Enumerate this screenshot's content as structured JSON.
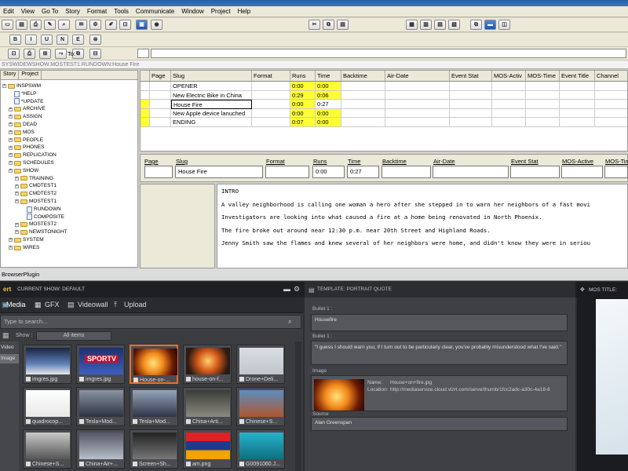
{
  "menu": [
    "Edit",
    "View",
    "Go To",
    "Story",
    "Format",
    "Tools",
    "Communicate",
    "Window",
    "Project",
    "Help"
  ],
  "format_buttons": [
    "B",
    "I",
    "U",
    "N",
    "E"
  ],
  "to_label": "To:",
  "path": "SYSWIDEWSHOW.MOSTEST1.RUNDOWN:House Fire",
  "tree": {
    "tabs": [
      "Story",
      "Project"
    ],
    "items": [
      {
        "label": "INSPSWM",
        "type": "folder",
        "indent": 0
      },
      {
        "label": "*HELP",
        "type": "doc",
        "indent": 1
      },
      {
        "label": "*UPDATE",
        "type": "doc",
        "indent": 1
      },
      {
        "label": "ARCHIVE",
        "type": "folder",
        "indent": 1
      },
      {
        "label": "ASSIGN",
        "type": "folder",
        "indent": 1
      },
      {
        "label": "DEAD",
        "type": "folder",
        "indent": 1
      },
      {
        "label": "MOS",
        "type": "folder",
        "indent": 1
      },
      {
        "label": "PEOPLE",
        "type": "folder",
        "indent": 1
      },
      {
        "label": "PHONES",
        "type": "folder",
        "indent": 1
      },
      {
        "label": "REPLICATION",
        "type": "folder",
        "indent": 1
      },
      {
        "label": "SCHEDULES",
        "type": "folder",
        "indent": 1
      },
      {
        "label": "SHOW",
        "type": "folder",
        "indent": 1
      },
      {
        "label": "TRAINING",
        "type": "folder",
        "indent": 2
      },
      {
        "label": "CMDTEST1",
        "type": "folder",
        "indent": 2
      },
      {
        "label": "CMDTEST2",
        "type": "folder",
        "indent": 2
      },
      {
        "label": "MOSTEST1",
        "type": "folder",
        "indent": 2
      },
      {
        "label": "RUNDOWN",
        "type": "doc",
        "indent": 3
      },
      {
        "label": "COMPOSITE",
        "type": "doc",
        "indent": 3
      },
      {
        "label": "MOSTEST2",
        "type": "folder",
        "indent": 2
      },
      {
        "label": "NEWSTONIGHT",
        "type": "folder",
        "indent": 2
      },
      {
        "label": "SYSTEM",
        "type": "folder",
        "indent": 1
      },
      {
        "label": "WIRES",
        "type": "folder",
        "indent": 1
      }
    ]
  },
  "rundown": {
    "headers": [
      "Page",
      "Slug",
      "Format",
      "Runs",
      "Time",
      "Backtime",
      "Air-Date",
      "Event Stat",
      "MOS-Activ",
      "MOS-Time",
      "Event Title",
      "Channel"
    ],
    "rows": [
      {
        "slug": "OPENER",
        "runs": "0:00",
        "time": "0:00"
      },
      {
        "slug": "New Electric Bike in China",
        "runs": "0:29",
        "time": "0:06"
      },
      {
        "slug": "House Fire",
        "runs": "0:00",
        "time": "0:27"
      },
      {
        "slug": "New Apple device lanuched",
        "runs": "0:00",
        "time": "0:00"
      },
      {
        "slug": "ENDING",
        "runs": "0:07",
        "time": "0:00"
      }
    ]
  },
  "editrow": {
    "labels": [
      "Page",
      "Slug",
      "Format",
      "Runs",
      "Time",
      "Backtime",
      "Air-Date",
      "Event Stat",
      "MOS-Active",
      "MOS-Time"
    ],
    "slug": "House Fire",
    "runs": "0:00",
    "time": "0:27"
  },
  "script": [
    "INTRO",
    "A valley neighborhood is calling one woman a hero after she stepped in to warn her neighbors of a fast movi",
    "Investigators are looking into what caused a fire at a home being renovated in North Phoenix.",
    "The fire broke out around near 12:30 p.m. near 20th Street and Highland Roads.",
    "Jenny Smith saw the flames and knew several of her neighbors were home, and didn't know they were in seriou"
  ],
  "plugin": {
    "title": "BrowserPlugin",
    "logo": "ert",
    "current_show": "CURRENT SHOW: DEFAULT",
    "tabs": [
      "Media",
      "GFX",
      "Videowall",
      "Upload"
    ],
    "search_placeholder": "Type to search...",
    "show_label": "Show :",
    "show_value": "All items",
    "side": [
      "Video",
      "Image"
    ],
    "tiles": [
      "imgres.jpg",
      "imgres.jpg",
      "House-on-...",
      "house-on-f...",
      "Drone+Deli...",
      "quadrocop...",
      "Tesla+Mod...",
      "Tesla+Mod...",
      "China+Arti...",
      "Chinese+S...",
      "Chinese+S...",
      "China+Air+...",
      "Screen+Sh...",
      "am.png",
      "G0091060.J..."
    ],
    "template": "TEMPLATE: PORTRAIT QUOTE",
    "bullet1_label": "Bullet 1 :",
    "bullet1": "Housefire",
    "bullet2_label": "Bullet 1 :",
    "bullet2": "\"I guess I should warn you, if I turn out to be particularly clear, you've probably misunderstood what I've said.\"",
    "image_label": "Image",
    "name_label": "Name:",
    "name_value": "House+on+fire.jpg",
    "location_label": "Location:",
    "location_value": "http://mediaservice.cloud.vizrt.com/serve/thumb/1fcc2adc-a30c-4a18-8",
    "source_label": "Source",
    "source_value": "Alan Greenspan",
    "mos_title": "MOS TITLE:"
  }
}
